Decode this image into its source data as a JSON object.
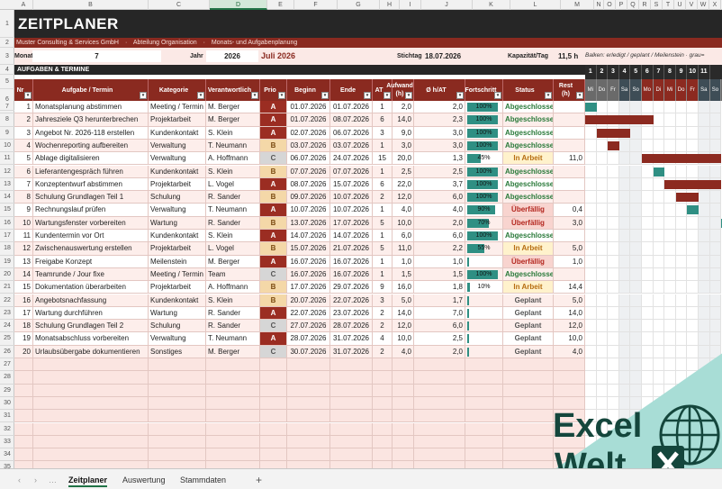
{
  "columns": [
    "A",
    "B",
    "C",
    "D",
    "E",
    "F",
    "G",
    "H",
    "I",
    "J",
    "K",
    "L",
    "M",
    "N",
    "O",
    "P",
    "Q",
    "R",
    "S",
    "T",
    "U",
    "V",
    "W",
    "X"
  ],
  "rows": [
    "1",
    "2",
    "3",
    "4",
    "5",
    "6",
    "7",
    "8",
    "9",
    "10",
    "11",
    "12",
    "13",
    "14",
    "15",
    "16",
    "17",
    "18",
    "19",
    "20",
    "21",
    "22",
    "23",
    "24",
    "25",
    "26",
    "27",
    "28",
    "29",
    "30",
    "31",
    "32",
    "33",
    "34",
    "35"
  ],
  "title": "ZEITPLANER",
  "breadcrumb": [
    "Muster Consulting & Services GmbH",
    "·",
    "Abteilung Organisation",
    "·",
    "Monats- und Aufgabenplanung"
  ],
  "info": {
    "monat_label": "Monat",
    "monat_value": "7",
    "jahr_label": "Jahr",
    "jahr_value": "2026",
    "month_name": "Juli 2026",
    "stichtag_label": "Stichtag",
    "stichtag_value": "18.07.2026",
    "kapazitaet_label": "Kapazität/Tag",
    "kapazitaet_value": "11,5 h"
  },
  "legend": "Balken: erledigt / geplant / Meilenstein · grau=",
  "section": "AUFGABEN & TERMINE",
  "headers": [
    "Nr",
    "Aufgabe / Termin",
    "Kategorie",
    "Verantwortlich",
    "Prio",
    "Beginn",
    "Ende",
    "AT",
    "Aufwand (h)",
    "Ø h/AT",
    "Fortschritt",
    "Status",
    "Rest (h)"
  ],
  "gantt_days": [
    "1",
    "2",
    "3",
    "4",
    "5",
    "6",
    "7",
    "8",
    "9",
    "10",
    "11"
  ],
  "gantt_weekdays": [
    "Mi",
    "Do",
    "Fr",
    "Sa",
    "So",
    "Mo",
    "Di",
    "Mi",
    "Do",
    "Fr",
    "Sa",
    "So"
  ],
  "tasks": [
    {
      "nr": "1",
      "task": "Monatsplanung abstimmen",
      "cat": "Meeting / Termin",
      "resp": "M. Berger",
      "prio": "A",
      "start": "01.07.2026",
      "end": "01.07.2026",
      "at": "1",
      "effort": "2,0",
      "avg": "2,0",
      "prog": "100%",
      "progv": 100,
      "status": "Abgeschlossen",
      "rest": ""
    },
    {
      "nr": "2",
      "task": "Jahresziele Q3 herunterbrechen",
      "cat": "Projektarbeit",
      "resp": "M. Berger",
      "prio": "A",
      "start": "01.07.2026",
      "end": "08.07.2026",
      "at": "6",
      "effort": "14,0",
      "avg": "2,3",
      "prog": "100%",
      "progv": 100,
      "status": "Abgeschlossen",
      "rest": ""
    },
    {
      "nr": "3",
      "task": "Angebot Nr. 2026-118 erstellen",
      "cat": "Kundenkontakt",
      "resp": "S. Klein",
      "prio": "A",
      "start": "02.07.2026",
      "end": "06.07.2026",
      "at": "3",
      "effort": "9,0",
      "avg": "3,0",
      "prog": "100%",
      "progv": 100,
      "status": "Abgeschlossen",
      "rest": ""
    },
    {
      "nr": "4",
      "task": "Wochenreporting aufbereiten",
      "cat": "Verwaltung",
      "resp": "T. Neumann",
      "prio": "B",
      "start": "03.07.2026",
      "end": "03.07.2026",
      "at": "1",
      "effort": "3,0",
      "avg": "3,0",
      "prog": "100%",
      "progv": 100,
      "status": "Abgeschlossen",
      "rest": ""
    },
    {
      "nr": "5",
      "task": "Ablage digitalisieren",
      "cat": "Verwaltung",
      "resp": "A. Hoffmann",
      "prio": "C",
      "start": "06.07.2026",
      "end": "24.07.2026",
      "at": "15",
      "effort": "20,0",
      "avg": "1,3",
      "prog": "45%",
      "progv": 45,
      "status": "In Arbeit",
      "rest": "11,0"
    },
    {
      "nr": "6",
      "task": "Lieferantengespräch führen",
      "cat": "Kundenkontakt",
      "resp": "S. Klein",
      "prio": "B",
      "start": "07.07.2026",
      "end": "07.07.2026",
      "at": "1",
      "effort": "2,5",
      "avg": "2,5",
      "prog": "100%",
      "progv": 100,
      "status": "Abgeschlossen",
      "rest": ""
    },
    {
      "nr": "7",
      "task": "Konzeptentwurf abstimmen",
      "cat": "Projektarbeit",
      "resp": "L. Vogel",
      "prio": "A",
      "start": "08.07.2026",
      "end": "15.07.2026",
      "at": "6",
      "effort": "22,0",
      "avg": "3,7",
      "prog": "100%",
      "progv": 100,
      "status": "Abgeschlossen",
      "rest": ""
    },
    {
      "nr": "8",
      "task": "Schulung Grundlagen Teil 1",
      "cat": "Schulung",
      "resp": "R. Sander",
      "prio": "B",
      "start": "09.07.2026",
      "end": "10.07.2026",
      "at": "2",
      "effort": "12,0",
      "avg": "6,0",
      "prog": "100%",
      "progv": 100,
      "status": "Abgeschlossen",
      "rest": ""
    },
    {
      "nr": "9",
      "task": "Rechnungslauf prüfen",
      "cat": "Verwaltung",
      "resp": "T. Neumann",
      "prio": "A",
      "start": "10.07.2026",
      "end": "10.07.2026",
      "at": "1",
      "effort": "4,0",
      "avg": "4,0",
      "prog": "90%",
      "progv": 90,
      "status": "Überfällig",
      "rest": "0,4"
    },
    {
      "nr": "10",
      "task": "Wartungsfenster vorbereiten",
      "cat": "Wartung",
      "resp": "R. Sander",
      "prio": "B",
      "start": "13.07.2026",
      "end": "17.07.2026",
      "at": "5",
      "effort": "10,0",
      "avg": "2,0",
      "prog": "70%",
      "progv": 70,
      "status": "Überfällig",
      "rest": "3,0"
    },
    {
      "nr": "11",
      "task": "Kundentermin vor Ort",
      "cat": "Kundenkontakt",
      "resp": "S. Klein",
      "prio": "A",
      "start": "14.07.2026",
      "end": "14.07.2026",
      "at": "1",
      "effort": "6,0",
      "avg": "6,0",
      "prog": "100%",
      "progv": 100,
      "status": "Abgeschlossen",
      "rest": ""
    },
    {
      "nr": "12",
      "task": "Zwischenauswertung erstellen",
      "cat": "Projektarbeit",
      "resp": "L. Vogel",
      "prio": "B",
      "start": "15.07.2026",
      "end": "21.07.2026",
      "at": "5",
      "effort": "11,0",
      "avg": "2,2",
      "prog": "55%",
      "progv": 55,
      "status": "In Arbeit",
      "rest": "5,0"
    },
    {
      "nr": "13",
      "task": "Freigabe Konzept",
      "cat": "Meilenstein",
      "resp": "M. Berger",
      "prio": "A",
      "start": "16.07.2026",
      "end": "16.07.2026",
      "at": "1",
      "effort": "1,0",
      "avg": "1,0",
      "prog": "",
      "progv": 2,
      "status": "Überfällig",
      "rest": "1,0"
    },
    {
      "nr": "14",
      "task": "Teamrunde / Jour fixe",
      "cat": "Meeting / Termin",
      "resp": "Team",
      "prio": "C",
      "start": "16.07.2026",
      "end": "16.07.2026",
      "at": "1",
      "effort": "1,5",
      "avg": "1,5",
      "prog": "100%",
      "progv": 100,
      "status": "Abgeschlossen",
      "rest": ""
    },
    {
      "nr": "15",
      "task": "Dokumentation überarbeiten",
      "cat": "Projektarbeit",
      "resp": "A. Hoffmann",
      "prio": "B",
      "start": "17.07.2026",
      "end": "29.07.2026",
      "at": "9",
      "effort": "16,0",
      "avg": "1,8",
      "prog": "10%",
      "progv": 10,
      "status": "In Arbeit",
      "rest": "14,4"
    },
    {
      "nr": "16",
      "task": "Angebotsnachfassung",
      "cat": "Kundenkontakt",
      "resp": "S. Klein",
      "prio": "B",
      "start": "20.07.2026",
      "end": "22.07.2026",
      "at": "3",
      "effort": "5,0",
      "avg": "1,7",
      "prog": "",
      "progv": 2,
      "status": "Geplant",
      "rest": "5,0"
    },
    {
      "nr": "17",
      "task": "Wartung durchführen",
      "cat": "Wartung",
      "resp": "R. Sander",
      "prio": "A",
      "start": "22.07.2026",
      "end": "23.07.2026",
      "at": "2",
      "effort": "14,0",
      "avg": "7,0",
      "prog": "",
      "progv": 2,
      "status": "Geplant",
      "rest": "14,0"
    },
    {
      "nr": "18",
      "task": "Schulung Grundlagen Teil 2",
      "cat": "Schulung",
      "resp": "R. Sander",
      "prio": "C",
      "start": "27.07.2026",
      "end": "28.07.2026",
      "at": "2",
      "effort": "12,0",
      "avg": "6,0",
      "prog": "",
      "progv": 2,
      "status": "Geplant",
      "rest": "12,0"
    },
    {
      "nr": "19",
      "task": "Monatsabschluss vorbereiten",
      "cat": "Verwaltung",
      "resp": "T. Neumann",
      "prio": "A",
      "start": "28.07.2026",
      "end": "31.07.2026",
      "at": "4",
      "effort": "10,0",
      "avg": "2,5",
      "prog": "",
      "progv": 2,
      "status": "Geplant",
      "rest": "10,0"
    },
    {
      "nr": "20",
      "task": "Urlaubsübergabe dokumentieren",
      "cat": "Sonstiges",
      "resp": "M. Berger",
      "prio": "C",
      "start": "30.07.2026",
      "end": "31.07.2026",
      "at": "2",
      "effort": "4,0",
      "avg": "2,0",
      "prog": "",
      "progv": 2,
      "status": "Geplant",
      "rest": "4,0"
    }
  ],
  "gantt_bars": [
    {
      "row": 0,
      "from": 0,
      "to": 0,
      "color": "#2f8f83"
    },
    {
      "row": 1,
      "from": 0,
      "to": 5,
      "color": "#8c2a20"
    },
    {
      "row": 2,
      "from": 1,
      "to": 3,
      "color": "#8c2a20"
    },
    {
      "row": 3,
      "from": 2,
      "to": 2,
      "color": "#8c2a20"
    },
    {
      "row": 4,
      "from": 5,
      "to": 11,
      "color": "#8c2a20"
    },
    {
      "row": 5,
      "from": 6,
      "to": 6,
      "color": "#2f8f83"
    },
    {
      "row": 6,
      "from": 7,
      "to": 11,
      "color": "#8c2a20"
    },
    {
      "row": 7,
      "from": 8,
      "to": 9,
      "color": "#8c2a20"
    },
    {
      "row": 8,
      "from": 9,
      "to": 9,
      "color": "#2f8f83"
    },
    {
      "row": 9,
      "from": 12,
      "to": 12,
      "color": "#2f8f83"
    }
  ],
  "sheet_tabs": [
    "Zeitplaner",
    "Auswertung",
    "Stammdaten"
  ],
  "logo": {
    "line1": "Excel",
    "line2": "Welt"
  }
}
